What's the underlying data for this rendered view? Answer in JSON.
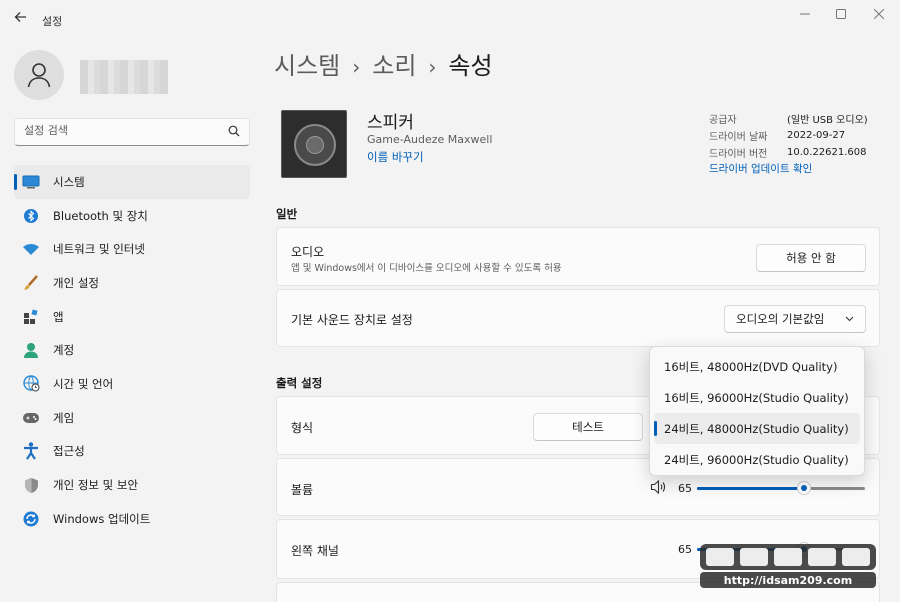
{
  "window": {
    "title": "설정",
    "back_icon": "back-arrow-icon",
    "controls": [
      "minimize-icon",
      "maximize-icon",
      "close-icon"
    ]
  },
  "sidebar": {
    "search_placeholder": "설정 검색",
    "items": [
      {
        "label": "시스템",
        "icon": "system-display-icon",
        "active": true
      },
      {
        "label": "Bluetooth 및 장치",
        "icon": "bluetooth-icon"
      },
      {
        "label": "네트워크 및 인터넷",
        "icon": "wifi-icon"
      },
      {
        "label": "개인 설정",
        "icon": "brush-icon"
      },
      {
        "label": "앱",
        "icon": "apps-icon"
      },
      {
        "label": "계정",
        "icon": "account-icon"
      },
      {
        "label": "시간 및 언어",
        "icon": "globe-clock-icon"
      },
      {
        "label": "게임",
        "icon": "gamepad-icon"
      },
      {
        "label": "접근성",
        "icon": "accessibility-icon"
      },
      {
        "label": "개인 정보 및 보안",
        "icon": "shield-icon"
      },
      {
        "label": "Windows 업데이트",
        "icon": "update-icon"
      }
    ]
  },
  "breadcrumb": [
    "시스템",
    "소리",
    "속성"
  ],
  "device": {
    "name": "스피커",
    "model": "Game-Audeze Maxwell",
    "rename_link": "이름 바꾸기",
    "info": [
      {
        "key": "공급자",
        "value": "(일반 USB 오디오)"
      },
      {
        "key": "드라이버 날짜",
        "value": "2022-09-27"
      },
      {
        "key": "드라이버 버전",
        "value": "10.0.22621.608"
      }
    ],
    "driver_update_link": "드라이버 업데이트 확인"
  },
  "general": {
    "section_title": "일반",
    "audio": {
      "title": "오디오",
      "subtitle": "앱 및 Windows에서 이 디바이스를 오디오에 사용할 수 있도록 허용",
      "button": "허용 안 함"
    },
    "default_device": {
      "title": "기본 사운드 장치로 설정",
      "dropdown_value": "오디오의 기본값임"
    }
  },
  "output": {
    "section_title": "출력 설정",
    "format": {
      "title": "형식",
      "test_button": "테스트",
      "options": [
        "16비트, 48000Hz(DVD Quality)",
        "16비트, 96000Hz(Studio Quality)",
        "24비트, 48000Hz(Studio Quality)",
        "24비트, 96000Hz(Studio Quality)"
      ],
      "selected_index": 2
    },
    "volume": {
      "title": "볼륨",
      "value": "65",
      "icon": "speaker-volume-icon"
    },
    "left_channel": {
      "title": "왼쪽 채널",
      "value": "65"
    }
  },
  "watermark_text": "http://idsam209.com",
  "colors": {
    "accent": "#005fb8",
    "background": "#f3f3f3",
    "card": "#fbfbfb"
  }
}
